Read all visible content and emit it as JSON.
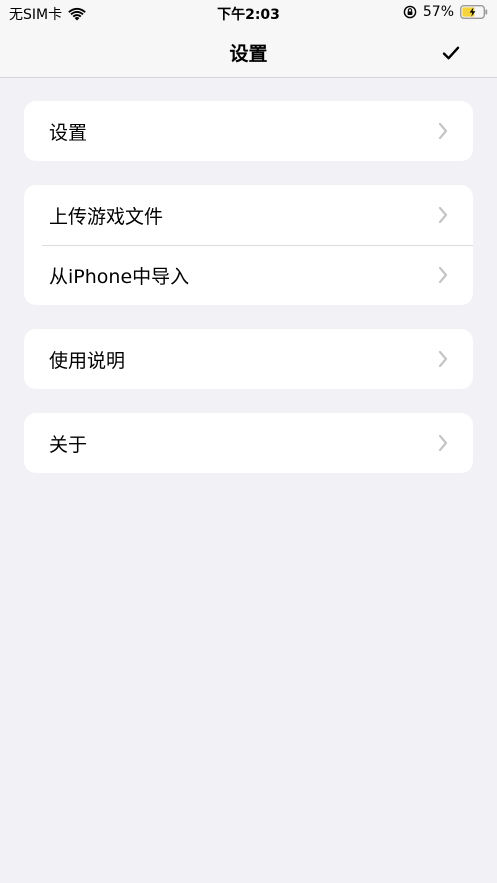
{
  "status_bar": {
    "carrier": "无SIM卡",
    "time": "下午2:03",
    "battery_percent": "57%"
  },
  "nav": {
    "title": "设置"
  },
  "groups": [
    {
      "items": [
        {
          "label": "设置"
        }
      ]
    },
    {
      "items": [
        {
          "label": "上传游戏文件"
        },
        {
          "label": "从iPhone中导入"
        }
      ]
    },
    {
      "items": [
        {
          "label": "使用说明"
        }
      ]
    },
    {
      "items": [
        {
          "label": "关于"
        }
      ]
    }
  ],
  "icons": {
    "wifi": "wifi-icon",
    "rotation_lock": "rotation-lock-icon",
    "battery": "battery-charging-icon",
    "done": "checkmark-icon",
    "chevron": "chevron-right-icon"
  },
  "colors": {
    "background": "#f2f1f6",
    "card": "#ffffff",
    "chevron": "#c4c4c7",
    "battery_fill": "#f5d33c"
  }
}
